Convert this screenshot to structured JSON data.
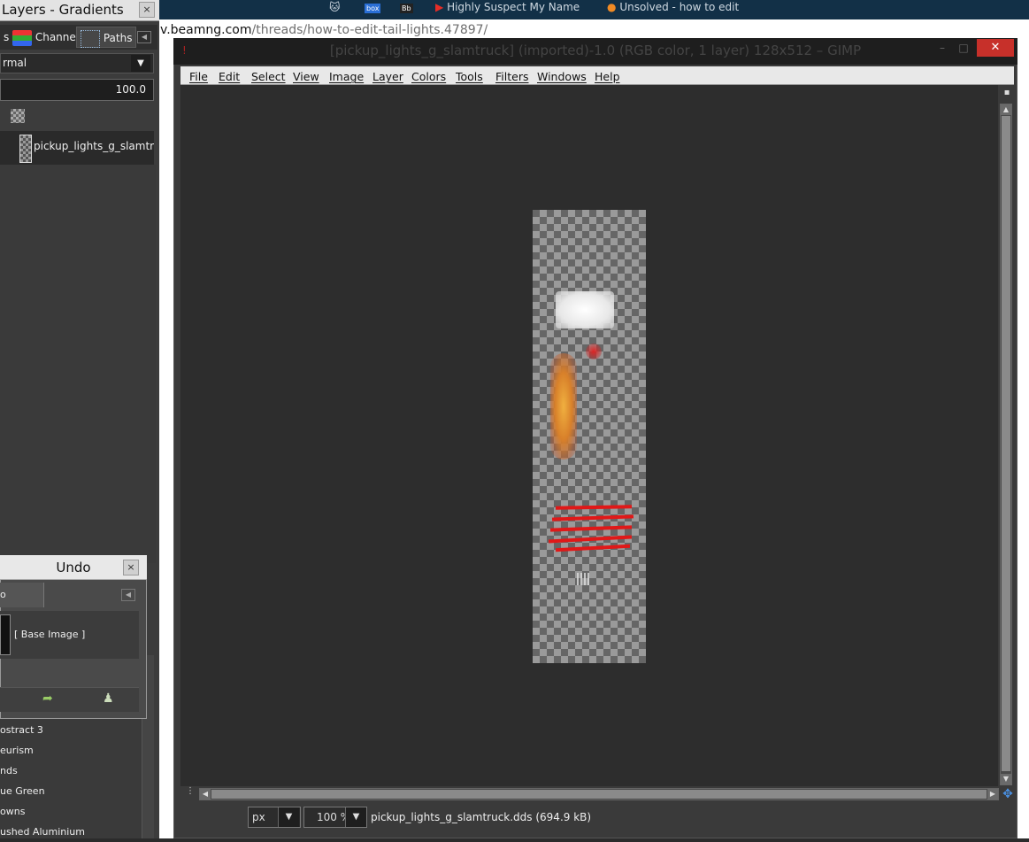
{
  "layers_dock": {
    "title": "Layers - Gradients",
    "close_label": "×",
    "tabs": [
      {
        "label": "s",
        "icon": "layers-icon"
      },
      {
        "label": "Channels",
        "icon": "channels-icon"
      },
      {
        "label": "Paths",
        "icon": "paths-icon"
      }
    ],
    "mode": "rmal",
    "opacity": "100.0",
    "layer_name": "pickup_lights_g_slamtruck.d"
  },
  "undo_dialog": {
    "title": "Undo",
    "close_label": "×",
    "tab_label": "o History",
    "entry": "[ Base Image ]"
  },
  "gradients_list": [
    "ostract 3",
    "eurism",
    "nds",
    "ue Green",
    "owns",
    "ushed Aluminium"
  ],
  "browser": {
    "tabs": [
      "",
      "",
      "",
      "Highly Suspect My Name",
      "Unsolved - how to edit"
    ],
    "address_host": "v.beamng.com",
    "address_path": "/threads/how-to-edit-tail-lights.47897/"
  },
  "gimp": {
    "title": "[pickup_lights_g_slamtruck] (imported)-1.0 (RGB color, 1 layer) 128x512 – GIMP",
    "close_label": "✕",
    "menu": [
      "File",
      "Edit",
      "Select",
      "View",
      "Image",
      "Layer",
      "Colors",
      "Tools",
      "Filters",
      "Windows",
      "Help"
    ],
    "status": {
      "unit": "px",
      "zoom": "100 %",
      "file_info": "pickup_lights_g_slamtruck.dds (694.9 kB)"
    }
  },
  "colors": {
    "menubar_bg": "#e8e8e8",
    "canvas_bg": "#2d2d2d",
    "close_red": "#c7302a",
    "light_red": "#e01818",
    "light_amber": "#e0a030"
  }
}
